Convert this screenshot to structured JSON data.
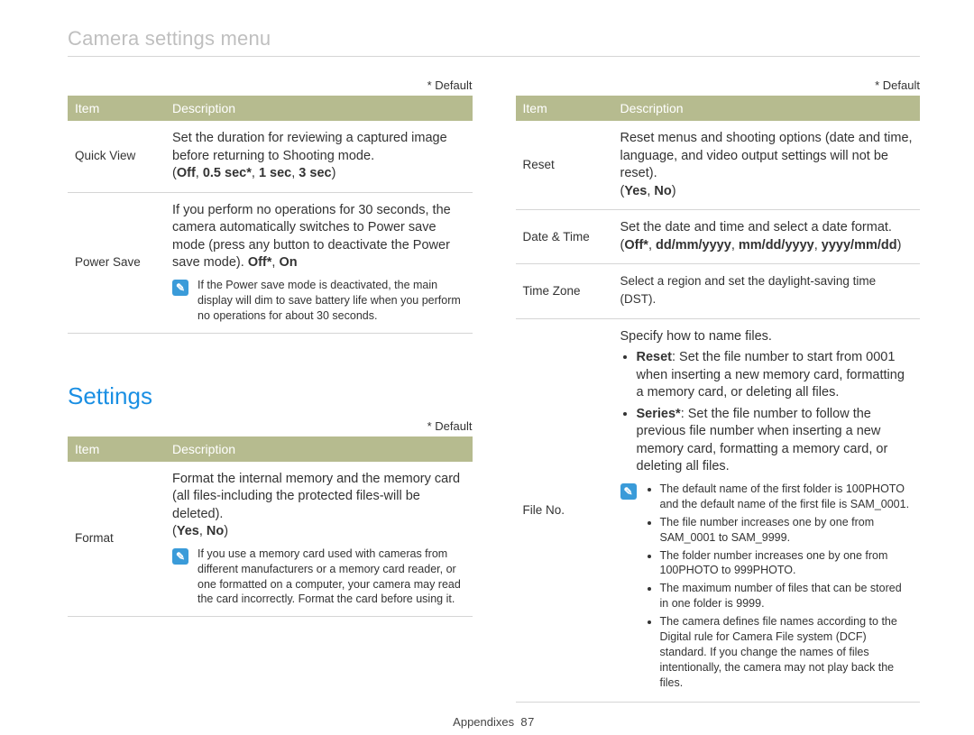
{
  "page_title": "Camera settings menu",
  "default_label": "* Default",
  "table_headers": {
    "item": "Item",
    "description": "Description"
  },
  "section_heading": "Settings",
  "footer_label": "Appendixes",
  "footer_page": "87",
  "note_glyph": "✎",
  "left": {
    "table1": {
      "rows": [
        {
          "item": "Quick View",
          "desc_main": "Set the duration for reviewing a captured image before returning to Shooting mode.",
          "opts_prefix": "(",
          "opts": [
            "Off",
            "0.5 sec*",
            "1 sec",
            "3 sec"
          ],
          "opts_suffix": ")"
        },
        {
          "item": "Power Save",
          "desc_main": "If you perform no operations for 30 seconds, the camera automatically switches to Power save mode (press any button to deactivate the Power save mode). ",
          "inline_opts": [
            "Off*",
            "On"
          ],
          "note": "If the Power save mode is deactivated, the main display will dim to save battery life when you perform no operations for about 30 seconds."
        }
      ]
    },
    "table2": {
      "rows": [
        {
          "item": "Format",
          "desc_main": "Format the internal memory and the memory card (all files-including the protected files-will be deleted).",
          "opts_prefix": "(",
          "opts": [
            "Yes",
            "No"
          ],
          "opts_suffix": ")",
          "note": "If you use a memory card used with cameras from different manufacturers or a memory card reader, or one formatted on a computer, your camera may read the card incorrectly. Format the card before using it."
        }
      ]
    }
  },
  "right": {
    "rows": [
      {
        "item": "Reset",
        "desc_main": "Reset menus and shooting options (date and time, language, and video output settings will not be reset).",
        "opts_prefix": "(",
        "opts": [
          "Yes",
          "No"
        ],
        "opts_suffix": ")"
      },
      {
        "item": "Date & Time",
        "desc_main": "Set the date and time and select a date format.",
        "opts_prefix": "(",
        "opts": [
          "Off*",
          "dd/mm/yyyy",
          "mm/dd/yyyy",
          "yyyy/mm/dd"
        ],
        "opts_suffix": ")"
      },
      {
        "item": "Time Zone",
        "desc_main": "Select a region and set the daylight-saving time (DST)."
      },
      {
        "item": "File No.",
        "desc_main": "Specify how to name files.",
        "bullets": [
          {
            "lead": "Reset",
            "text": ": Set the file number to start from 0001 when inserting a new memory card, formatting a memory card, or deleting all files."
          },
          {
            "lead": "Series*",
            "text": ": Set the file number to follow the previous file number when inserting a new memory card, formatting a memory card, or deleting all files."
          }
        ],
        "note_list": [
          "The default name of the first folder is 100PHOTO and the default name of the first file is SAM_0001.",
          "The file number increases one by one from SAM_0001 to SAM_9999.",
          "The folder number increases one by one from 100PHOTO to 999PHOTO.",
          "The maximum number of files that can be stored in one folder is 9999.",
          "The camera defines file names according to the Digital rule for Camera File system (DCF) standard. If you change the names of files intentionally, the camera may not play back the files."
        ]
      }
    ]
  }
}
